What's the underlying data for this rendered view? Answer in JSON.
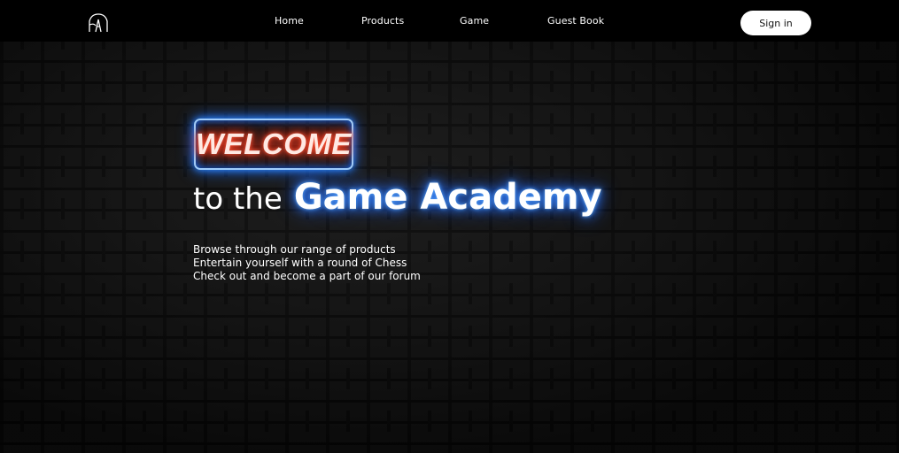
{
  "header": {
    "logo_icon": "academy-logo-icon",
    "nav": [
      "Home",
      "Products",
      "Game",
      "Guest Book"
    ],
    "signin_label": "Sign in"
  },
  "hero": {
    "sign_text": "WELCOME",
    "tagline_prefix": "to the",
    "tagline_brand": "Game Academy",
    "lines": [
      "Browse through our range of products",
      "Entertain yourself with a round of Chess",
      "Check out and become a part of our forum"
    ]
  },
  "colors": {
    "header_bg": "#000000",
    "neon_blue": "#2f7dff",
    "neon_red": "#ff3a1f",
    "button_bg": "#ffffff"
  }
}
